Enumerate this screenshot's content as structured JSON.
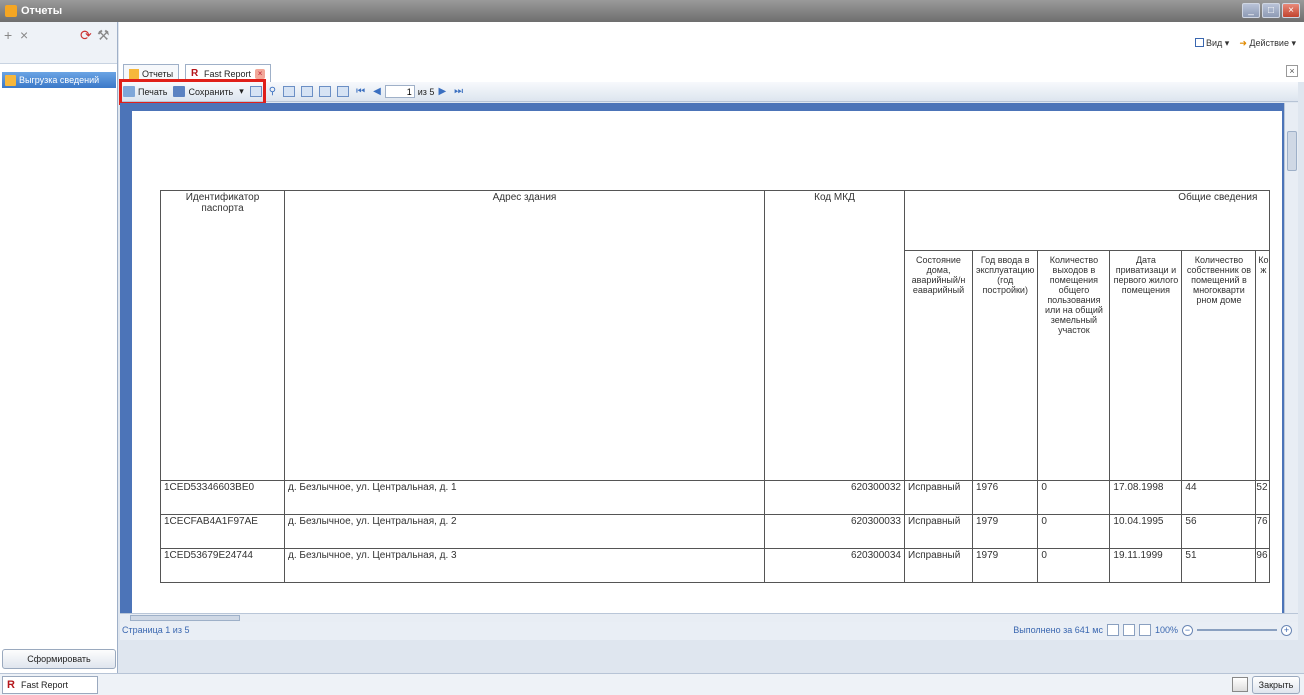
{
  "window": {
    "title": "Отчеты"
  },
  "sidebar": {
    "item_label": "Выгрузка сведений",
    "form_button": "Сформировать"
  },
  "topbar": {
    "view_label": "Вид",
    "action_label": "Действие"
  },
  "tabs": [
    {
      "label": "Отчеты"
    },
    {
      "label": "Fast Report"
    }
  ],
  "report_toolbar": {
    "print_label": "Печать",
    "save_label": "Сохранить",
    "page_value": "1",
    "page_of": "из 5"
  },
  "table": {
    "headers": {
      "id": "Идентификатор паспорта",
      "address": "Адрес здания",
      "code": "Код МКД",
      "general": "Общие сведения"
    },
    "subheaders": [
      "Состояние дома, аварийный/н еаварийный",
      "Год ввода в эксплуатацию (год постройки)",
      "Количество выходов в помещения общего пользования или на общий земельный участок",
      "Дата приватизаци и первого жилого помещения",
      "Количество собственник ов помещений в многокварти рном доме",
      "Ко ж"
    ],
    "rows": [
      {
        "id": "1CED53346603BE0",
        "address": "д. Безлычное, ул. Центральная, д. 1",
        "code": "620300032",
        "state": "Исправный",
        "year": "1976",
        "exits": "0",
        "date": "17.08.1998",
        "owners": "44",
        "extra": "52"
      },
      {
        "id": "1CECFAB4A1F97AE",
        "address": "д. Безлычное, ул. Центральная, д. 2",
        "code": "620300033",
        "state": "Исправный",
        "year": "1979",
        "exits": "0",
        "date": "10.04.1995",
        "owners": "56",
        "extra": "76"
      },
      {
        "id": "1CED53679E24744",
        "address": "д. Безлычное, ул. Центральная, д. 3",
        "code": "620300034",
        "state": "Исправный",
        "year": "1979",
        "exits": "0",
        "date": "19.11.1999",
        "owners": "51",
        "extra": "96"
      }
    ]
  },
  "status": {
    "page_text": "Страница 1 из 5",
    "elapsed": "Выполнено за 641 мс",
    "zoom": "100%"
  },
  "bottom": {
    "tab_label": "Fast Report",
    "close_label": "Закрыть"
  }
}
